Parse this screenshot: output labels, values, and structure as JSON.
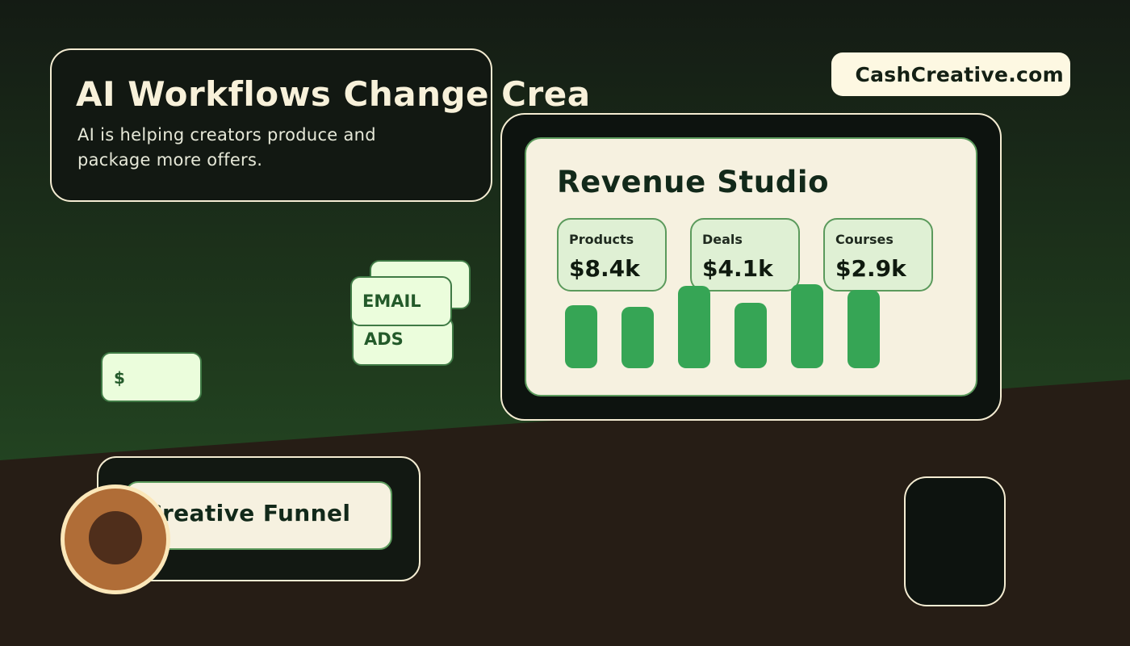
{
  "headline": {
    "title": "AI Workflows Change Crea",
    "subtitle": "AI is helping creators produce and package more offers."
  },
  "brand": {
    "label": "CashCreative.com"
  },
  "dashboard": {
    "title": "Revenue Studio",
    "stats": [
      {
        "label": "Products",
        "value": "$8.4k"
      },
      {
        "label": "Deals",
        "value": "$4.1k"
      },
      {
        "label": "Courses",
        "value": "$2.9k"
      }
    ],
    "bar_levels": [
      0.75,
      0.73,
      0.98,
      0.78,
      1.0,
      0.93
    ]
  },
  "chips": {
    "email": "EMAIL",
    "ads": "ADS",
    "money": "$"
  },
  "funnel": {
    "label": "Creative Funnel"
  },
  "colors": {
    "accent_green": "#36a555",
    "cream": "#f6f1e0",
    "dark_panel": "#121812",
    "coin": "#b06d37"
  },
  "icons": {
    "coin": "coin-icon",
    "phone": "phone-icon"
  }
}
